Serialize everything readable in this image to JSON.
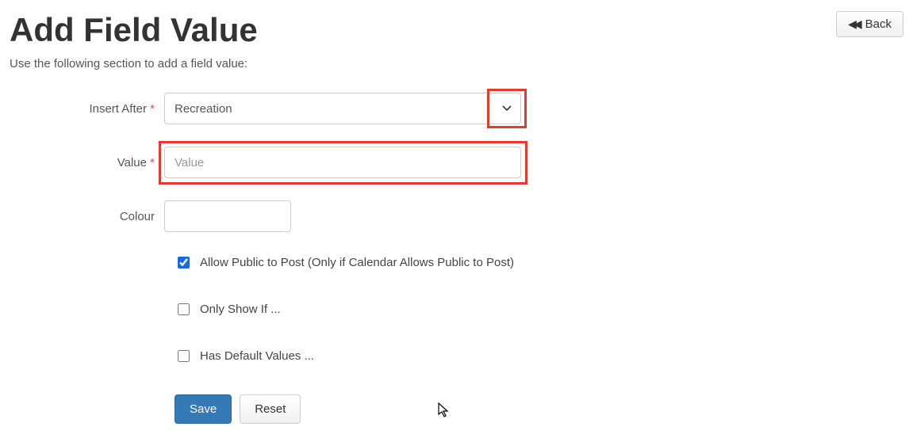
{
  "header": {
    "title": "Add Field Value",
    "subtitle": "Use the following section to add a field value:",
    "back_label": "Back"
  },
  "form": {
    "insert_after": {
      "label": "Insert After",
      "value": "Recreation"
    },
    "value": {
      "label": "Value",
      "placeholder": "Value"
    },
    "colour": {
      "label": "Colour"
    },
    "allow_public": {
      "label": "Allow Public to Post (Only if Calendar Allows Public to Post)",
      "checked": true
    },
    "only_show_if": {
      "label": "Only Show If ...",
      "checked": false
    },
    "has_defaults": {
      "label": "Has Default Values ...",
      "checked": false
    },
    "save_label": "Save",
    "reset_label": "Reset"
  }
}
